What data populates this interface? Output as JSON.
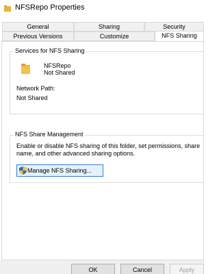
{
  "window": {
    "title": "NFSRepo Properties"
  },
  "tabs_row1": [
    {
      "label": "General"
    },
    {
      "label": "Sharing"
    },
    {
      "label": "Security"
    }
  ],
  "tabs_row2": [
    {
      "label": "Previous Versions"
    },
    {
      "label": "Customize"
    },
    {
      "label": "NFS Sharing",
      "active": true
    }
  ],
  "services": {
    "group_label": "Services for NFS Sharing",
    "folder_name": "NFSRepo",
    "status": "Not Shared",
    "network_path_label": "Network Path:",
    "network_path_value": "Not Shared"
  },
  "management": {
    "group_label": "NFS Share Management",
    "description_line1": "Enable or disable NFS sharing of this folder, set permissions, share",
    "description_line2": "name, and other advanced sharing options.",
    "button_label": "Manage NFS Sharing..."
  },
  "footer": {
    "ok_label": "OK",
    "cancel_label": "Cancel",
    "apply_label": "Apply"
  },
  "colors": {
    "folder": "#e8b43a",
    "button_focus_border": "#2f7fd7",
    "panel_border": "#d9d9d9"
  }
}
